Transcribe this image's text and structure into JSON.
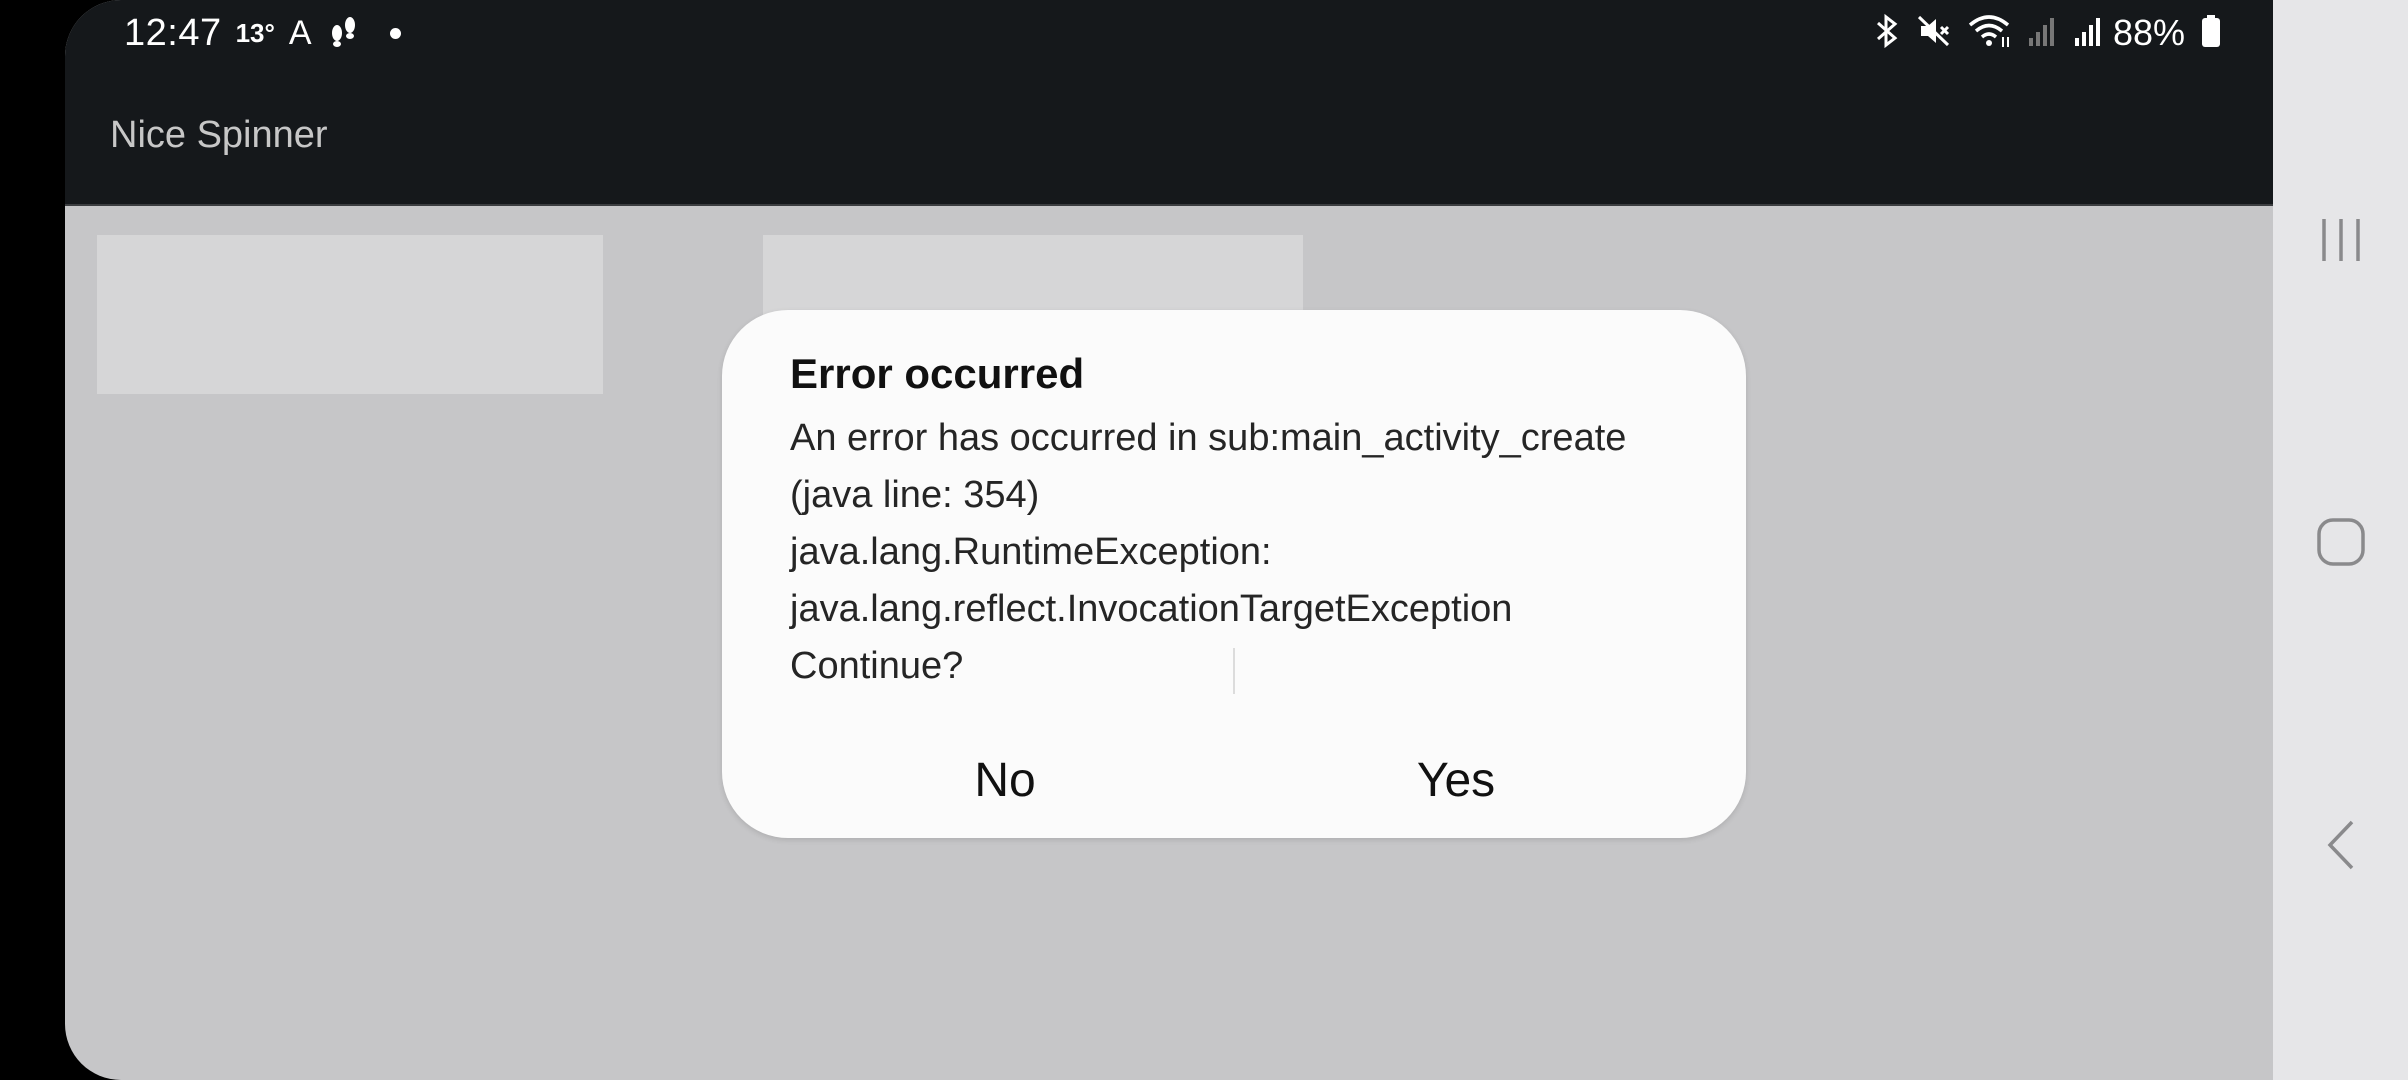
{
  "status_bar": {
    "time": "12:47",
    "temperature": "13°",
    "auto_icon_text": "A",
    "battery": "88%",
    "icons": [
      "steps-icon",
      "dot-icon",
      "bluetooth-icon",
      "mute-icon",
      "wifi-icon",
      "signal-icon",
      "signal-icon",
      "battery-icon"
    ]
  },
  "app_bar": {
    "title": "Nice Spinner"
  },
  "dialog": {
    "title": "Error occurred",
    "body_lines": [
      "An error has occurred in sub:main_activity_create",
      "(java line: 354)",
      "java.lang.RuntimeException:",
      "java.lang.reflect.InvocationTargetException",
      "Continue?"
    ],
    "no_label": "No",
    "yes_label": "Yes"
  },
  "nav_bar": {
    "icons": [
      "recent-apps-icon",
      "home-icon",
      "back-icon"
    ]
  },
  "colors": {
    "status_bar_bg": "#15181b",
    "app_bg": "#c6c6c8",
    "dialog_bg": "#fbfbfb",
    "nav_bg": "#e6e6e8"
  }
}
